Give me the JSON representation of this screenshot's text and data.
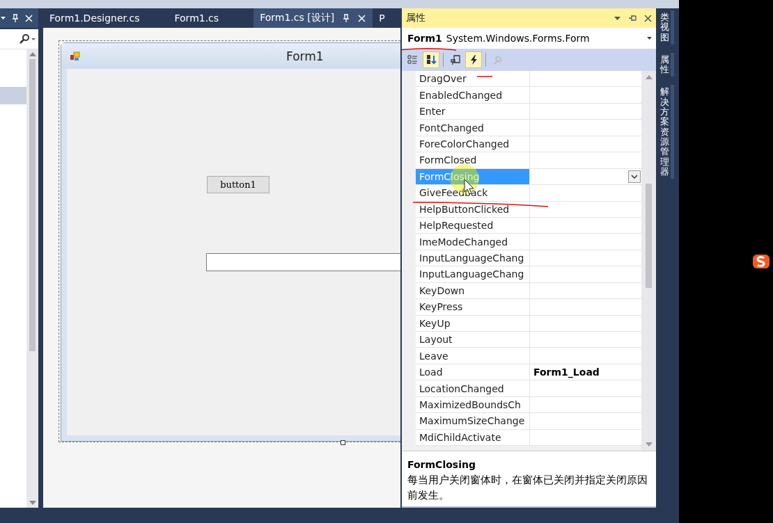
{
  "editor_tabs": [
    {
      "label": "Form1.Designer.cs",
      "selected": false
    },
    {
      "label": "Form1.cs",
      "selected": false
    },
    {
      "label": "Form1.cs [设计]",
      "selected": true
    },
    {
      "label": "P",
      "selected": false
    }
  ],
  "designer": {
    "form_title": "Form1",
    "button_label": "button1"
  },
  "properties": {
    "title": "属性",
    "object_name": "Form1",
    "object_type": "System.Windows.Forms.Form",
    "toolbar": [
      {
        "kind": "categorized",
        "selected": false,
        "disabled": false
      },
      {
        "kind": "alphabetical",
        "selected": true,
        "disabled": false
      },
      {
        "kind": "properties",
        "selected": false,
        "disabled": false
      },
      {
        "kind": "events",
        "selected": true,
        "disabled": false
      },
      {
        "kind": "pages",
        "selected": false,
        "disabled": true
      }
    ],
    "events": [
      {
        "name": "DragOver",
        "selected": false
      },
      {
        "name": "EnabledChanged",
        "selected": false
      },
      {
        "name": "Enter",
        "selected": false
      },
      {
        "name": "FontChanged",
        "selected": false
      },
      {
        "name": "ForeColorChanged",
        "selected": false
      },
      {
        "name": "FormClosed",
        "selected": false
      },
      {
        "name": "FormClosing",
        "selected": true
      },
      {
        "name": "GiveFeedback",
        "selected": false
      },
      {
        "name": "HelpButtonClicked",
        "selected": false
      },
      {
        "name": "HelpRequested",
        "selected": false
      },
      {
        "name": "ImeModeChanged",
        "selected": false
      },
      {
        "name": "InputLanguageChang",
        "selected": false
      },
      {
        "name": "InputLanguageChang",
        "selected": false
      },
      {
        "name": "KeyDown",
        "selected": false
      },
      {
        "name": "KeyPress",
        "selected": false
      },
      {
        "name": "KeyUp",
        "selected": false
      },
      {
        "name": "Layout",
        "selected": false
      },
      {
        "name": "Leave",
        "selected": false
      },
      {
        "name": "Load",
        "value": "Form1_Load",
        "selected": false
      },
      {
        "name": "LocationChanged",
        "selected": false
      },
      {
        "name": "MaximizedBoundsCh",
        "selected": false
      },
      {
        "name": "MaximumSizeChange",
        "selected": false
      },
      {
        "name": "MdiChildActivate",
        "selected": false
      }
    ],
    "description": {
      "title": "FormClosing",
      "text": "每当用户关闭窗体时，在窗体已关闭并指定关闭原因前发生。"
    }
  },
  "side_tabs": [
    {
      "label": "类视图"
    },
    {
      "label": "属性"
    },
    {
      "label": "解决方案资源管理器"
    }
  ]
}
